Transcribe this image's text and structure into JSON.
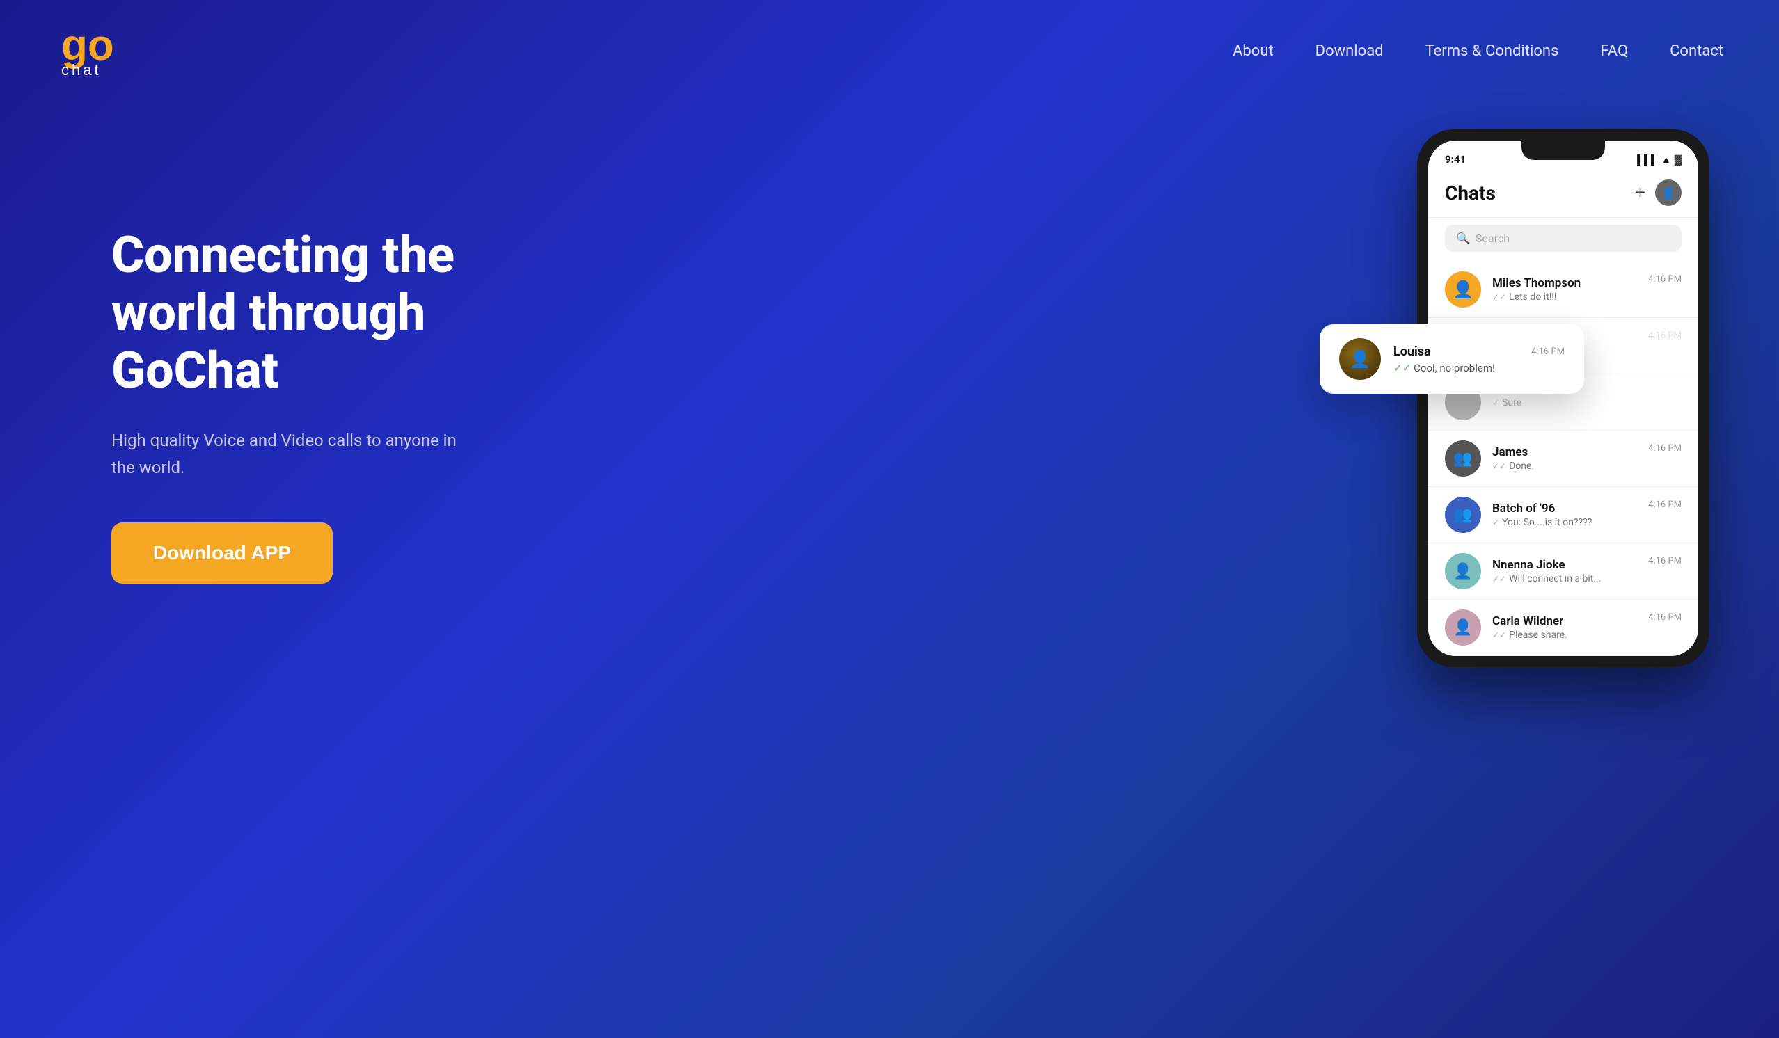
{
  "header": {
    "logo_go": "go",
    "logo_chat": "chat",
    "nav": {
      "about": "About",
      "download": "Download",
      "terms": "Terms & Conditions",
      "faq": "FAQ",
      "contact": "Contact"
    }
  },
  "hero": {
    "title": "Connecting the world through GoChat",
    "subtitle": "High quality Voice and Video calls to anyone in the world.",
    "download_btn": "Download APP"
  },
  "phone": {
    "status_time": "9:41",
    "chats_title": "Chats",
    "search_placeholder": "Search",
    "chat_items": [
      {
        "name": "Miles Thompson",
        "preview": "Lets do it!!!",
        "time": "4:16 PM",
        "avatar_color": "orange",
        "avatar_letter": "👤"
      },
      {
        "name": "James",
        "preview": "Done.",
        "time": "4:16 PM",
        "avatar_color": "dark",
        "avatar_letter": "👥"
      },
      {
        "name": "Batch of '96",
        "preview": "You: So....is it on????",
        "time": "4:16 PM",
        "avatar_color": "blue",
        "avatar_letter": "👥"
      },
      {
        "name": "Nnenna Jioke",
        "preview": "Will connect in a bit...",
        "time": "4:16 PM",
        "avatar_color": "teal",
        "avatar_letter": "👤"
      },
      {
        "name": "Carla Wildner",
        "preview": "Please share.",
        "time": "4:16 PM",
        "avatar_color": "pink",
        "avatar_letter": "👤"
      }
    ],
    "notification": {
      "name": "Louisa",
      "time": "4:16 PM",
      "message": "Cool, no problem!"
    }
  }
}
